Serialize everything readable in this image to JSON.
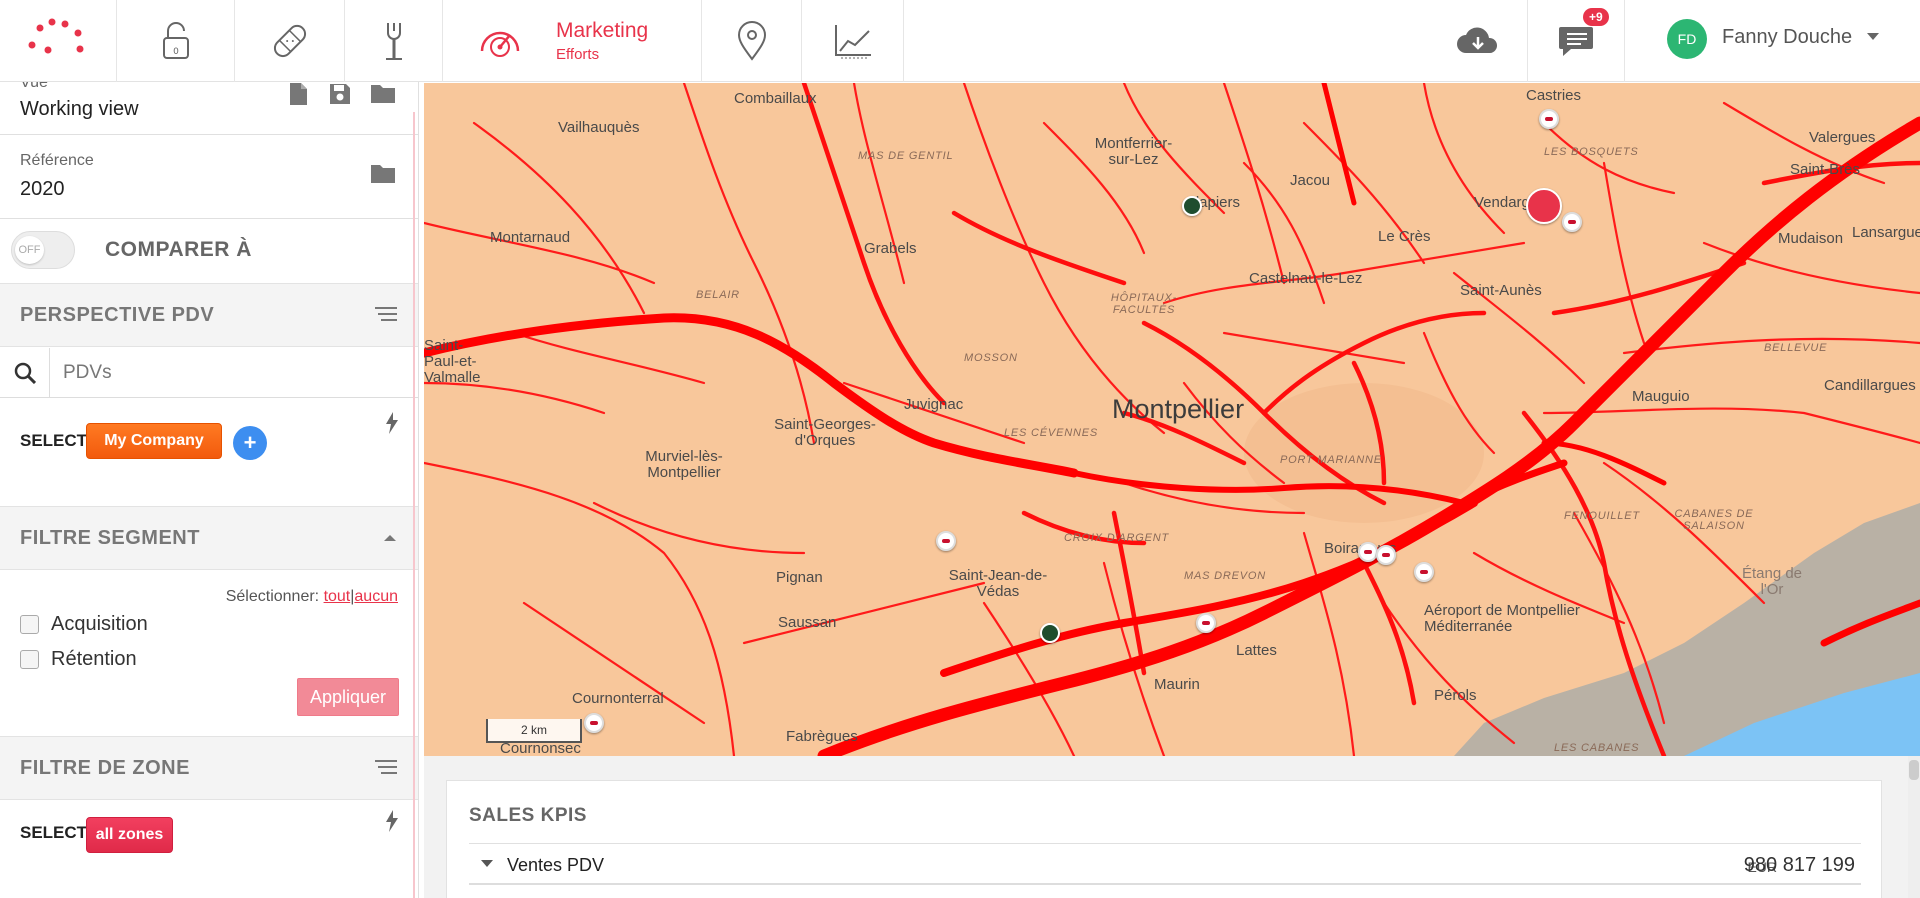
{
  "topbar": {
    "marketing_title": "Marketing",
    "marketing_subtitle": "Efforts",
    "notifications_badge": "+9",
    "user_initials": "FD",
    "user_name": "Fanny Douche",
    "accent_color": "#e8334a"
  },
  "sidebar": {
    "vue_label": "Vue",
    "vue_value": "Working view",
    "reference_label": "Référence",
    "reference_value": "2020",
    "toggle_state": "OFF",
    "compare_label": "COMPARER À",
    "perspective_title": "PERSPECTIVE PDV",
    "search_placeholder": "PDVs",
    "select_label": "SELECT",
    "company_chip": "My Company",
    "add_label": "+",
    "segment_title": "FILTRE SEGMENT",
    "select_prefix": "Sélectionner:",
    "select_all": "tout",
    "select_sep": "|",
    "select_none": "aucun",
    "segments": [
      "Acquisition",
      "Rétention"
    ],
    "apply_label": "Appliquer",
    "zone_title": "FILTRE DE ZONE",
    "zone_select_label": "SELECT",
    "zone_chip": "all zones"
  },
  "map": {
    "scale_label": "2 km",
    "places": [
      "Castries",
      "Combaillaux",
      "Vailhauquès",
      "Montferrier-sur-Lez",
      "Valergues",
      "Saint-Brès",
      "Jacou",
      "Clapiers",
      "Vendargues",
      "Lansargues",
      "Montarnaud",
      "Grabels",
      "Le Crès",
      "Castelnau-le-Lez",
      "Saint-Aunès",
      "Mudaison",
      "Murviel-lès-Montpellier",
      "Juvignac",
      "Montpellier",
      "Saint-Georges-d'Orques",
      "Mauguio",
      "Candillargues",
      "Pignan",
      "Saint-Jean-de-Védas",
      "Boirargues",
      "Aéroport de Montpellier Méditerranée",
      "Étang de l'Or",
      "Saussan",
      "Lattes",
      "Cournonterral",
      "Maurin",
      "Pérols",
      "Fabrègues",
      "Cournonsec",
      "Saint-Paul-et-Valmalle"
    ],
    "districts": [
      "MAS DE GENTIL",
      "BELAIR",
      "HÔPITAUX-FACULTÉS",
      "MOSSON",
      "LES CÉVENNES",
      "CROIX D'ARGENT",
      "PORT MARIANNE",
      "MAS DREVON",
      "LES BOSQUETS",
      "BELLEVUE",
      "CABANES DE SALAISON",
      "FENOUILLET",
      "LES CABANES"
    ]
  },
  "kpi": {
    "title": "SALES KPIS",
    "row_label": "Ventes PDV",
    "currency": "EUR",
    "value": "980 817 199"
  }
}
